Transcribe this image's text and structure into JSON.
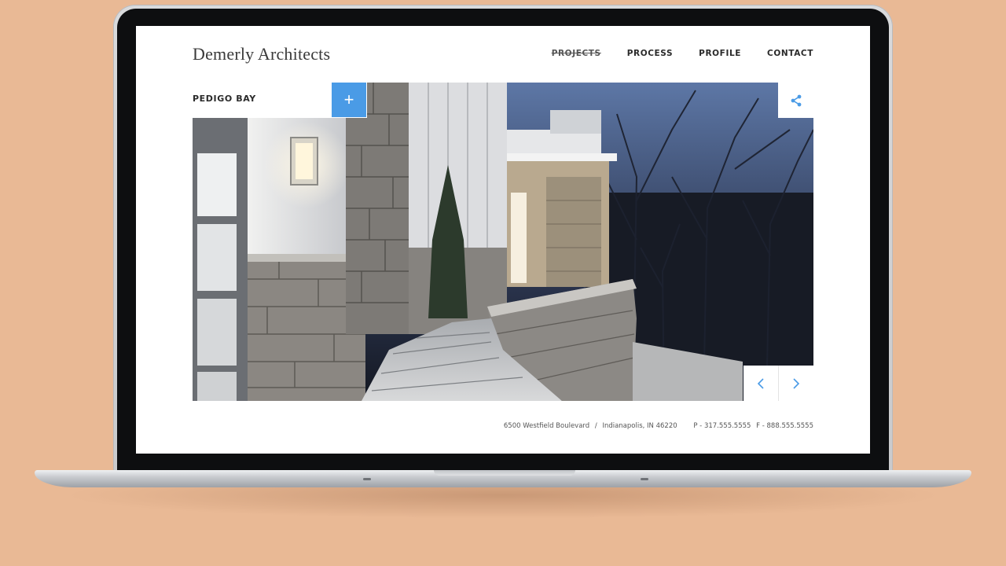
{
  "site": {
    "logo": "Demerly Architects",
    "nav": [
      {
        "label": "PROJECTS",
        "active": true
      },
      {
        "label": "PROCESS",
        "active": false
      },
      {
        "label": "PROFILE",
        "active": false
      },
      {
        "label": "CONTACT",
        "active": false
      }
    ],
    "project_title": "PEDIGO BAY",
    "plus_symbol": "+",
    "icons": {
      "share": "share-icon",
      "prev": "chevron-left-icon",
      "next": "chevron-right-icon"
    },
    "footer": {
      "street": "6500 Westfield Boulevard",
      "separator": "/",
      "city": "Indianapolis, IN 46220",
      "phone": "P - 317.555.5555",
      "fax": "F - 888.555.5555"
    }
  },
  "colors": {
    "background": "#E9B995",
    "accent": "#4A9BE6"
  }
}
